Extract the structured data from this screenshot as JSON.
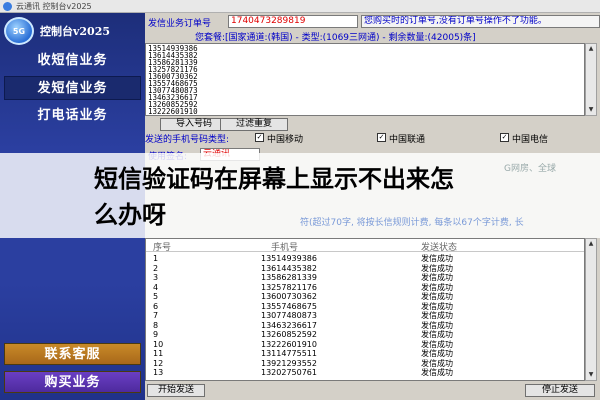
{
  "window": {
    "title": "云通讯 控制台v2025"
  },
  "sidebar": {
    "logo_text": "5G",
    "brand": "控制台v2025",
    "nav": [
      {
        "label": "收短信业务"
      },
      {
        "label": "发短信业务"
      },
      {
        "label": "打电话业务"
      }
    ],
    "service_label": "联系客服",
    "buy_label": "购买业务"
  },
  "order": {
    "label": "发信业务订单号",
    "value": "1740473289819",
    "hint": "您购买时的订单号,没有订单号操作不了功能。"
  },
  "package_info": "您套餐:[国家通道:(韩国) - 类型:(1069三网通) - 剩余数量:(42005)条]",
  "numbers": [
    "13514939386",
    "13614435382",
    "13586281339",
    "13257821176",
    "13600730362",
    "13557468675",
    "13077480873",
    "13463236617",
    "13260852592",
    "13222601910"
  ],
  "buttons": {
    "import": "导入号码",
    "dedupe": "过滤重复",
    "start": "开始发送",
    "stop": "停止发送"
  },
  "number_type": {
    "label": "发送的手机号码类型:",
    "options": [
      {
        "label": "中国移动",
        "checked": true
      },
      {
        "label": "中国联通",
        "checked": true
      },
      {
        "label": "中国电信",
        "checked": true
      }
    ]
  },
  "signature": {
    "label": "使用签名:",
    "value": "云通讯",
    "side_text": "G网房、全球"
  },
  "overlay": {
    "headline": "短信验证码在屏幕上显示不出来怎么办呀",
    "faded_line": "符(超过70字, 将按长信规则计费, 每条以67个字计费, 长"
  },
  "table": {
    "headers": {
      "index": "序号",
      "phone": "手机号",
      "status": "发送状态"
    },
    "rows": [
      {
        "index": "1",
        "phone": "13514939386",
        "status": "发信成功"
      },
      {
        "index": "2",
        "phone": "13614435382",
        "status": "发信成功"
      },
      {
        "index": "3",
        "phone": "13586281339",
        "status": "发信成功"
      },
      {
        "index": "4",
        "phone": "13257821176",
        "status": "发信成功"
      },
      {
        "index": "5",
        "phone": "13600730362",
        "status": "发信成功"
      },
      {
        "index": "6",
        "phone": "13557468675",
        "status": "发信成功"
      },
      {
        "index": "7",
        "phone": "13077480873",
        "status": "发信成功"
      },
      {
        "index": "8",
        "phone": "13463236617",
        "status": "发信成功"
      },
      {
        "index": "9",
        "phone": "13260852592",
        "status": "发信成功"
      },
      {
        "index": "10",
        "phone": "13222601910",
        "status": "发信成功"
      },
      {
        "index": "11",
        "phone": "13114775511",
        "status": "发信成功"
      },
      {
        "index": "12",
        "phone": "13921293552",
        "status": "发信成功"
      },
      {
        "index": "13",
        "phone": "13202750761",
        "status": "发信成功"
      }
    ]
  },
  "colors": {
    "sidebar": "#2b3fa0",
    "accent_blue": "#0000c8",
    "order_red": "#e00000"
  }
}
